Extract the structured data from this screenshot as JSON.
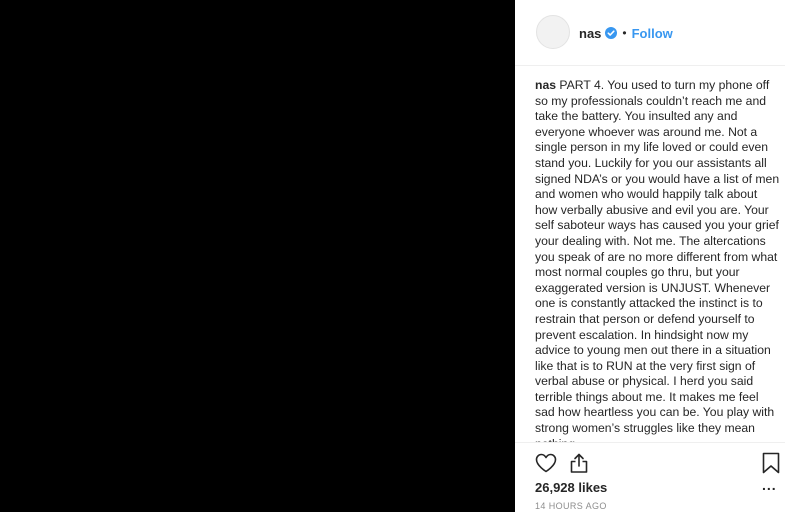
{
  "post": {
    "username": "nas",
    "follow_label": "Follow",
    "dot": "•",
    "caption": {
      "username": "nas",
      "text": "PART 4. You used to turn my phone off so my professionals couldn’t reach me and take the battery. You insulted any and everyone whoever was around me. Not a single person in my life loved or could even stand you. Luckily for you our assistants all signed NDA’s or you would have a list of men and women who would happily talk about how verbally abusive and evil you are. Your self saboteur ways has caused you your grief your dealing with. Not me. The altercations you speak of are no more different from what most normal couples go thru, but your exaggerated version is UNJUST. Whenever one is constantly attacked the instinct is to restrain that person or defend yourself to prevent escalation. In hindsight now my advice to young men out there in a situation like that is to RUN at the very first sign of verbal abuse or physical. I herd you said terrible things about me. It makes me feel sad how heartless you can be. You play with strong women’s struggles like they mean nothing."
    },
    "likes": "26,928 likes",
    "timestamp": "14 HOURS AGO",
    "more_label": "...",
    "icons": {
      "verified": "verified-badge-icon",
      "like": "heart-icon",
      "share": "share-icon",
      "save": "bookmark-icon"
    }
  },
  "colors": {
    "media_bg": "#000000",
    "link": "#3897f0",
    "text": "#262626",
    "muted": "#8e8e8e",
    "verified": "#3897f0"
  }
}
